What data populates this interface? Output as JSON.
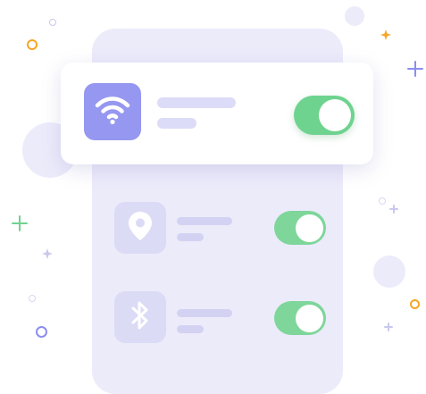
{
  "scene": {
    "main_setting": {
      "icon": "wifi-icon",
      "toggle_on": true
    },
    "settings": [
      {
        "icon": "location-pin-icon",
        "toggle_on": true
      },
      {
        "icon": "bluetooth-icon",
        "toggle_on": true
      }
    ]
  },
  "colors": {
    "accent": "#9597f0",
    "phone": "#ecebfa",
    "toggle_on": "#6fd390",
    "decor_orange": "#f5a623",
    "decor_green": "#6fd390",
    "decor_purple": "#8c8df0"
  }
}
